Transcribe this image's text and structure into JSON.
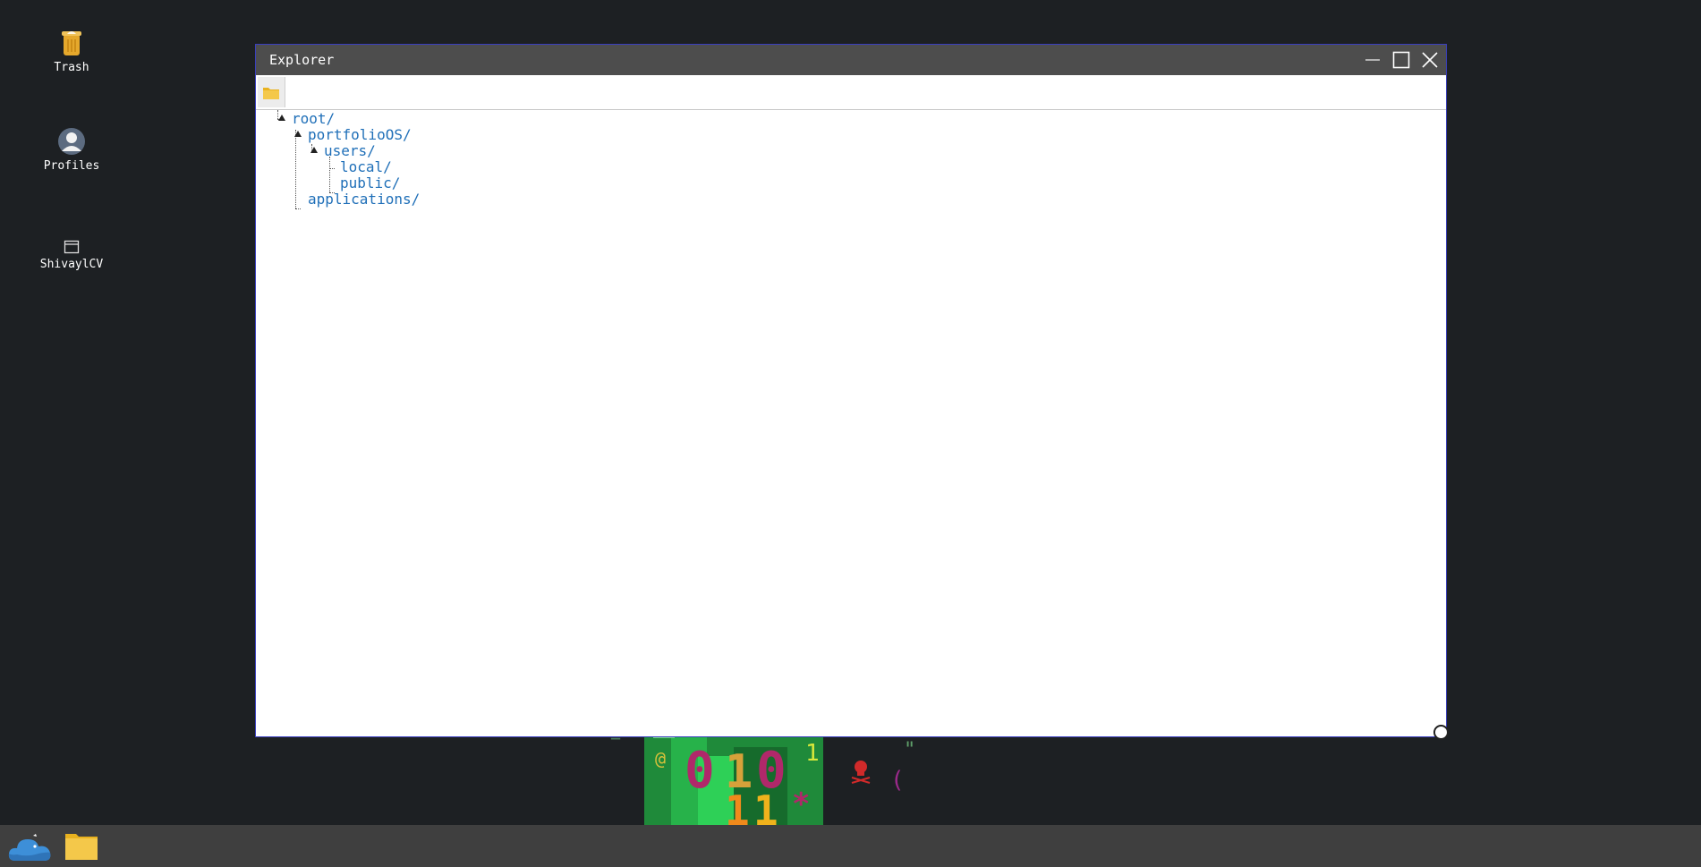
{
  "desktop": {
    "icons": [
      {
        "label": "Trash",
        "icon": "trash-can-icon"
      },
      {
        "label": "Profiles",
        "icon": "user-avatar-icon"
      },
      {
        "label": "ShivaylCV",
        "icon": "window-icon"
      }
    ]
  },
  "window": {
    "title": "Explorer",
    "controls": [
      "minimize",
      "maximize",
      "close"
    ]
  },
  "toolbar": {
    "folder_icon": "folder-icon"
  },
  "tree": {
    "root": "root/",
    "portfolio": "portfolioOS/",
    "users": "users/",
    "local": "local/",
    "public": "public/",
    "applications": "applications/"
  },
  "wallpaper": {
    "glyphs": [
      "0",
      "1",
      "0",
      "1",
      "1",
      "*",
      "@",
      "1",
      "(",
      "\"",
      "="
    ]
  },
  "colors": {
    "desktop_bg": "#1d2023",
    "titlebar": "#4d4d4d",
    "link": "#1f6fb8",
    "taskbar": "#3f3f3f",
    "window_border": "#3a3fbf"
  }
}
